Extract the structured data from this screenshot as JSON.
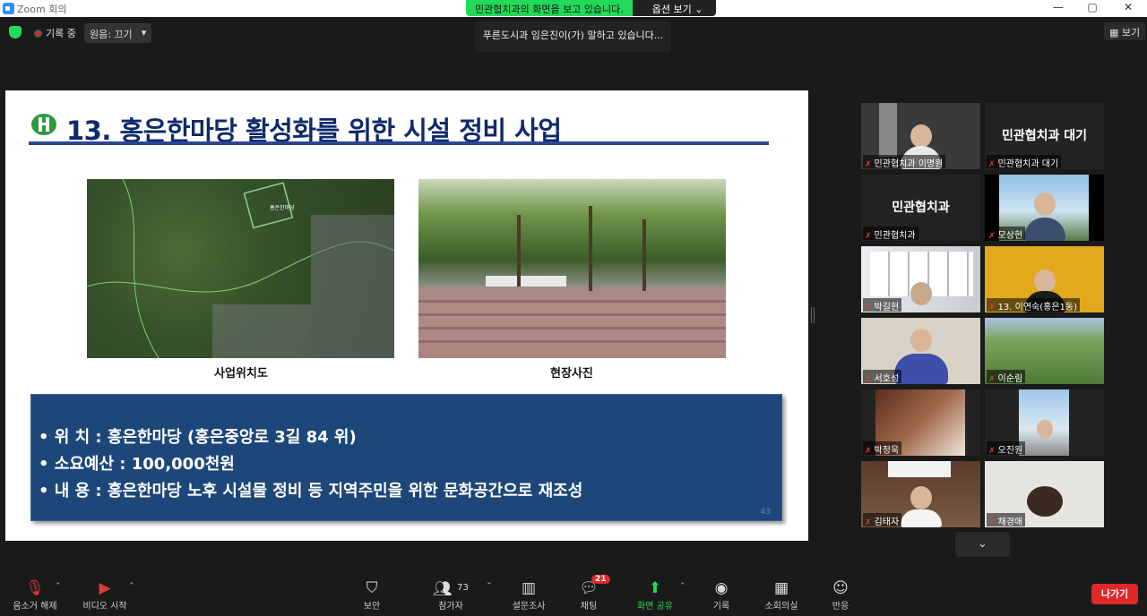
{
  "window": {
    "title": "Zoom 회의",
    "controls": [
      "—",
      "▢",
      "✕"
    ]
  },
  "share_banner": {
    "status": "민관협치과의 화면을 보고 있습니다.",
    "options": "옵션 보기 ⌄"
  },
  "top": {
    "recording": "기록 중",
    "audio": "원음: 끄기",
    "audio_caret": "▾",
    "speaking": "푸른도시과 임은진이(가) 말하고 있습니다...",
    "view": "보기"
  },
  "slide": {
    "title": "13. 홍은한마당 활성화를 위한 시설 정비 사업",
    "caption_left": "사업위치도",
    "caption_right": "현장사진",
    "map_label": "홍은한마당",
    "lines": [
      "•  위       치 : 홍은한마당 (홍은중앙로 3길 84 위)",
      "•  소요예산 : 100,000천원",
      "•  내       용 : 홍은한마당 노후 시설물 정비 등 지역주민을 위한 문화공간으로 재조성"
    ],
    "page_number": "43"
  },
  "participants": [
    {
      "name": "민관협치과 이명원",
      "type": "video"
    },
    {
      "name": "민관협치과 대기",
      "type": "name",
      "display": "민관협치과 대기"
    },
    {
      "name": "민관협치과",
      "type": "name",
      "display": "민관협치과"
    },
    {
      "name": "모상현",
      "type": "video"
    },
    {
      "name": "박길현",
      "type": "video"
    },
    {
      "name": "13. 이연숙(홍은1동)",
      "type": "video"
    },
    {
      "name": "서호성",
      "type": "video"
    },
    {
      "name": "이순림",
      "type": "video"
    },
    {
      "name": "박정욱",
      "type": "video"
    },
    {
      "name": "오진원",
      "type": "video"
    },
    {
      "name": "김태자",
      "type": "video"
    },
    {
      "name": "채경애",
      "type": "video"
    }
  ],
  "toolbar": {
    "mute": "음소거 해제",
    "video": "비디오 시작",
    "security": "보안",
    "participants": "참가자",
    "participant_count": "73",
    "polls": "설문조사",
    "chat": "채팅",
    "chat_badge": "21",
    "share": "화면 공유",
    "record": "기록",
    "breakout": "소회의실",
    "reactions": "반응",
    "leave": "나가기"
  },
  "colors": {
    "accent_green": "#23d959",
    "leave_red": "#e02828",
    "slide_box": "#1d4779",
    "title_navy": "#0f2a6b"
  }
}
